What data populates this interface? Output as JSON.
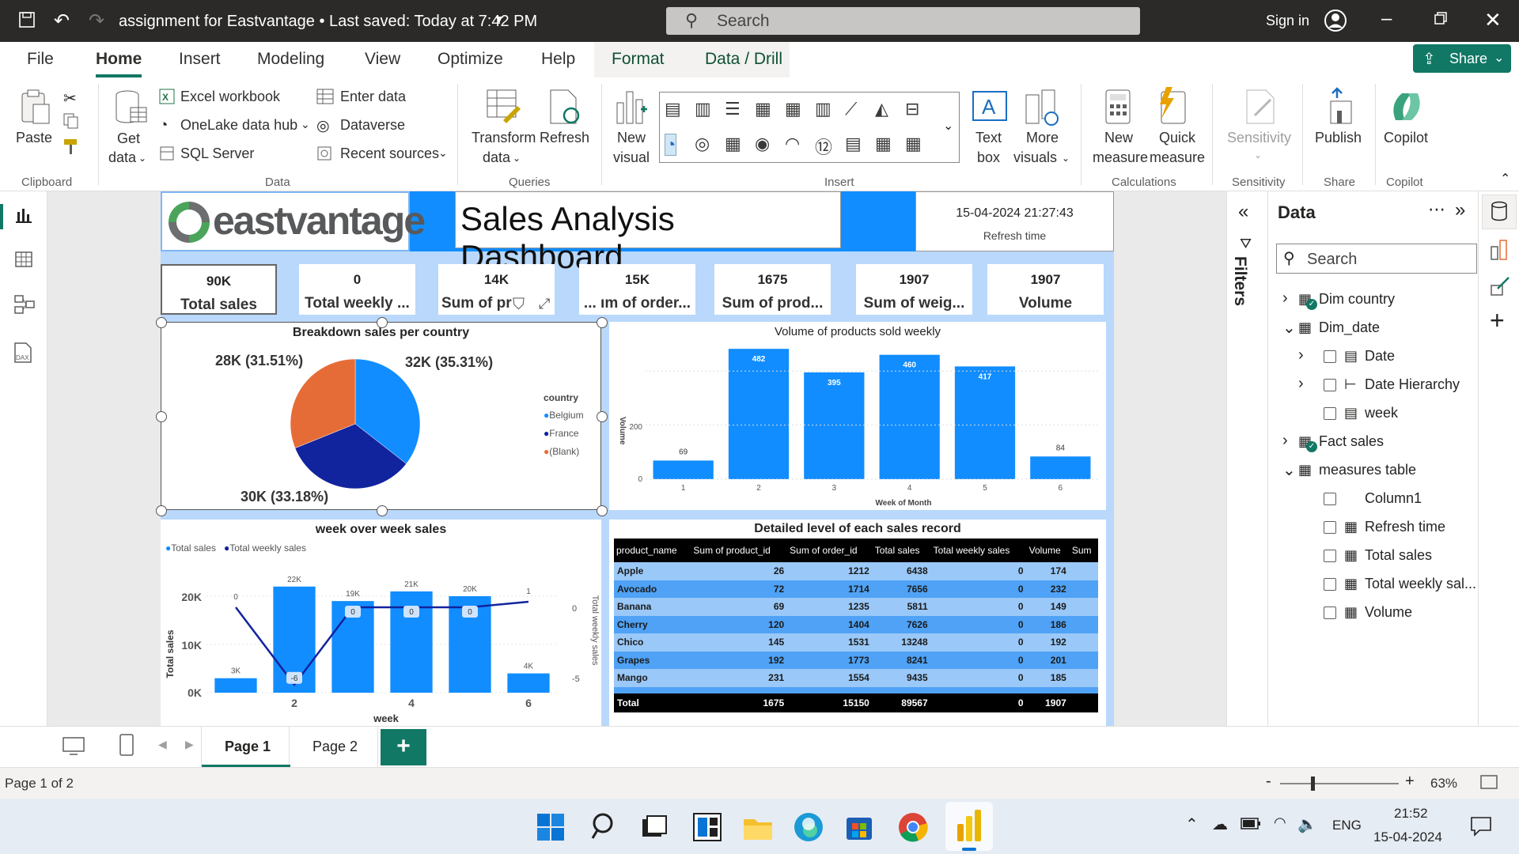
{
  "window": {
    "title": "assignment for Eastvantage • Last saved: Today at 7:42 PM",
    "search_placeholder": "Search",
    "sign_in": "Sign in"
  },
  "menu": {
    "items": [
      "File",
      "Home",
      "Insert",
      "Modeling",
      "View",
      "Optimize",
      "Help",
      "Format",
      "Data / Drill"
    ],
    "share": "Share"
  },
  "ribbon": {
    "clipboard": {
      "paste": "Paste",
      "group": "Clipboard"
    },
    "data": {
      "get_data_1": "Get",
      "get_data_2": "data",
      "excel": "Excel workbook",
      "onelake": "OneLake data hub",
      "sql": "SQL Server",
      "enter_data": "Enter data",
      "dataverse": "Dataverse",
      "recent": "Recent sources",
      "group": "Data"
    },
    "queries": {
      "transform_1": "Transform",
      "transform_2": "data",
      "refresh": "Refresh",
      "group": "Queries"
    },
    "insert": {
      "new_visual_1": "New",
      "new_visual_2": "visual",
      "text_box_1": "Text",
      "text_box_2": "box",
      "more_visuals_1": "More",
      "more_visuals_2": "visuals",
      "group": "Insert"
    },
    "calculations": {
      "new_measure_1": "New",
      "new_measure_2": "measure",
      "quick_measure_1": "Quick",
      "quick_measure_2": "measure",
      "group": "Calculations"
    },
    "sensitivity": {
      "label": "Sensitivity",
      "group": "Sensitivity"
    },
    "share": {
      "publish": "Publish",
      "group": "Share"
    },
    "copilot": {
      "label": "Copilot",
      "group": "Copilot"
    }
  },
  "report": {
    "logo": "eastvantage",
    "title": "Sales Analysis Dashboard",
    "refresh_value": "15-04-2024 21:27:43",
    "refresh_label": "Refresh time",
    "cards": [
      {
        "value": "90K",
        "label": "Total sales"
      },
      {
        "value": "0",
        "label": "Total weekly ..."
      },
      {
        "value": "14K",
        "label": "Sum of pr"
      },
      {
        "value": "15K",
        "label": "... ım of order..."
      },
      {
        "value": "1675",
        "label": "Sum of prod..."
      },
      {
        "value": "1907",
        "label": "Sum of weig..."
      },
      {
        "value": "1907",
        "label": "Volume"
      }
    ],
    "pie": {
      "title": "Breakdown sales per country",
      "legend_title": "country",
      "legend": [
        "Belgium",
        "France",
        "(Blank)"
      ],
      "labels": [
        "32K (35.31%)",
        "30K (33.18%)",
        "28K (31.51%)"
      ]
    },
    "bar": {
      "title": "Volume of products sold weekly",
      "ylabel": "Volume",
      "xlabel": "Week of Month",
      "yticks": [
        "0",
        "200"
      ]
    },
    "combo": {
      "title": "week over week sales",
      "legend": [
        "Total sales",
        "Total weekly sales"
      ],
      "ylabel_left": "Total sales",
      "ylabel_right": "Total weekly sales",
      "xlabel": "week",
      "yticks_left": [
        "0K",
        "10K",
        "20K"
      ],
      "yticks_right": [
        "-5",
        "0"
      ],
      "xticks": [
        "2",
        "4",
        "6"
      ]
    },
    "table": {
      "title": "Detailed level of each sales record",
      "columns": [
        "product_name",
        "Sum of product_id",
        "Sum of order_id",
        "Total sales",
        "Total weekly sales",
        "Volume",
        "Sum"
      ],
      "rows": [
        [
          "Apple",
          "26",
          "1212",
          "6438",
          "0",
          "174"
        ],
        [
          "Avocado",
          "72",
          "1714",
          "7656",
          "0",
          "232"
        ],
        [
          "Banana",
          "69",
          "1235",
          "5811",
          "0",
          "149"
        ],
        [
          "Cherry",
          "120",
          "1404",
          "7626",
          "0",
          "186"
        ],
        [
          "Chico",
          "145",
          "1531",
          "13248",
          "0",
          "192"
        ],
        [
          "Grapes",
          "192",
          "1773",
          "8241",
          "0",
          "201"
        ],
        [
          "Mango",
          "231",
          "1554",
          "9435",
          "0",
          "185"
        ]
      ],
      "total": [
        "Total",
        "1675",
        "15150",
        "89567",
        "0",
        "1907"
      ]
    }
  },
  "chart_data": [
    {
      "type": "pie",
      "title": "Breakdown sales per country",
      "categories": [
        "Belgium",
        "France",
        "(Blank)"
      ],
      "values": [
        32,
        30,
        28
      ],
      "percent": [
        35.31,
        33.18,
        31.51
      ],
      "colors": [
        "#118dff",
        "#12239e",
        "#e66c37"
      ]
    },
    {
      "type": "bar",
      "title": "Volume of products sold weekly",
      "xlabel": "Week of Month",
      "ylabel": "Volume",
      "categories": [
        "1",
        "2",
        "3",
        "4",
        "5",
        "6"
      ],
      "values": [
        69,
        482,
        395,
        460,
        417,
        84
      ],
      "ylim": [
        0,
        500
      ]
    },
    {
      "type": "bar",
      "title": "week over week sales",
      "xlabel": "week",
      "ylabel": "Total sales",
      "categories": [
        "1",
        "2",
        "3",
        "4",
        "5",
        "6"
      ],
      "series": [
        {
          "name": "Total sales",
          "values": [
            3,
            22,
            19,
            21,
            20,
            4
          ],
          "labels": [
            "3K",
            "22K",
            "19K",
            "21K",
            "20K",
            "4K"
          ]
        },
        {
          "name": "Total weekly sales",
          "values": [
            0,
            -6,
            0,
            0,
            0,
            1
          ],
          "labels": [
            "0",
            "-6",
            "0",
            "0",
            "0",
            "1"
          ]
        }
      ],
      "ylim": [
        0,
        22
      ]
    }
  ],
  "data_pane": {
    "title": "Data",
    "search_placeholder": "Search",
    "filters_label": "Filters",
    "items": [
      "Dim country",
      "Dim_date",
      "Date",
      "Date Hierarchy",
      "week",
      "Fact sales",
      "measures table",
      "Column1",
      "Refresh time",
      "Total sales",
      "Total weekly sal...",
      "Volume"
    ]
  },
  "pages": {
    "tabs": [
      "Page 1",
      "Page 2"
    ],
    "add": "+"
  },
  "status": {
    "page_info": "Page 1 of 2",
    "zoom": "63%"
  },
  "taskbar": {
    "lang": "ENG",
    "time": "21:52",
    "date": "15-04-2024"
  },
  "colors": {
    "accent": "#117865",
    "blue": "#118dff",
    "navy": "#12239e",
    "orange": "#e66c37"
  }
}
